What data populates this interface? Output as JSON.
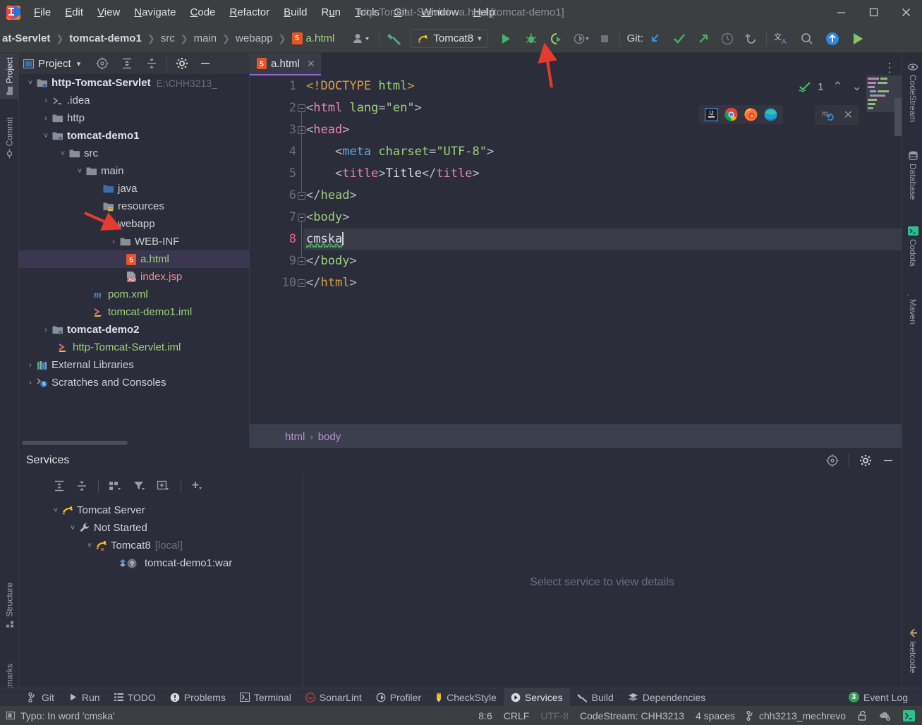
{
  "window": {
    "title": "http-Tomcat-Servlet - a.html [tomcat-demo1]",
    "minimize": "—",
    "maximize": "☐",
    "close": "✕"
  },
  "menu": [
    {
      "label": "File",
      "mnemonic": "F"
    },
    {
      "label": "Edit",
      "mnemonic": "E"
    },
    {
      "label": "View",
      "mnemonic": "V"
    },
    {
      "label": "Navigate",
      "mnemonic": "N"
    },
    {
      "label": "Code",
      "mnemonic": "C"
    },
    {
      "label": "Refactor",
      "mnemonic": "R"
    },
    {
      "label": "Build",
      "mnemonic": "B"
    },
    {
      "label": "Run",
      "mnemonic": "u"
    },
    {
      "label": "Tools",
      "mnemonic": "T"
    },
    {
      "label": "Git",
      "mnemonic": "G"
    },
    {
      "label": "Window",
      "mnemonic": "W"
    },
    {
      "label": "Help",
      "mnemonic": "H"
    }
  ],
  "navbar": {
    "crumbs": [
      {
        "label": "at-Servlet",
        "bold": true
      },
      {
        "label": "tomcat-demo1",
        "bold": true
      },
      {
        "label": "src",
        "bold": false
      },
      {
        "label": "main",
        "bold": false
      },
      {
        "label": "webapp",
        "bold": false
      },
      {
        "label": "a.html",
        "bold": false,
        "file": true,
        "badge": "5"
      }
    ],
    "run_config": "Tomcat8",
    "git_label": "Git:"
  },
  "left_strip": [
    {
      "label": "Project",
      "icon": "project-icon",
      "active": true
    },
    {
      "label": "Commit",
      "icon": "commit-icon",
      "active": false
    },
    {
      "label": "Structure",
      "icon": "structure-icon",
      "active": false
    },
    {
      "label": "Bookmarks",
      "icon": "bookmarks-icon",
      "active": false
    }
  ],
  "right_strip": [
    {
      "label": "CodeStream",
      "icon": "codestream-icon"
    },
    {
      "label": "Database",
      "icon": "database-icon"
    },
    {
      "label": "Codota",
      "icon": "codota-icon"
    },
    {
      "label": "Maven",
      "icon": "maven-icon"
    },
    {
      "label": "leetcode",
      "icon": "leetcode-icon"
    }
  ],
  "project_panel": {
    "title": "Project",
    "tree": [
      {
        "depth": 0,
        "arrow": "down",
        "icon": "module-folder-icon",
        "label": "http-Tomcat-Servlet",
        "bold": true,
        "path": "E:\\CHH3213_",
        "selected": false
      },
      {
        "depth": 1,
        "arrow": "right",
        "icon": "idea-folder-icon",
        "label": ".idea",
        "bold": false,
        "selected": false
      },
      {
        "depth": 1,
        "arrow": "right",
        "icon": "folder-icon",
        "label": "http",
        "bold": false,
        "selected": false
      },
      {
        "depth": 1,
        "arrow": "down",
        "icon": "module-folder-icon",
        "label": "tomcat-demo1",
        "bold": true,
        "selected": false
      },
      {
        "depth": 2,
        "arrow": "down",
        "icon": "folder-icon",
        "label": "src",
        "bold": false,
        "selected": false
      },
      {
        "depth": 3,
        "arrow": "down",
        "icon": "folder-icon",
        "label": "main",
        "bold": false,
        "selected": false
      },
      {
        "depth": 4,
        "arrow": "none",
        "icon": "source-folder-icon",
        "label": "java",
        "bold": false,
        "selected": false
      },
      {
        "depth": 4,
        "arrow": "none",
        "icon": "resource-folder-icon",
        "label": "resources",
        "bold": false,
        "selected": false
      },
      {
        "depth": 4,
        "arrow": "none",
        "icon": "webapp-folder-icon",
        "label": "webapp",
        "bold": false,
        "selected": false
      },
      {
        "depth": 5,
        "arrow": "right",
        "icon": "folder-icon",
        "label": "WEB-INF",
        "bold": false,
        "selected": false
      },
      {
        "depth": 5,
        "arrow": "none",
        "icon": "html5-file-icon",
        "label": "a.html",
        "bold": false,
        "color": "green",
        "selected": true
      },
      {
        "depth": 5,
        "arrow": "none",
        "icon": "jsp-file-icon",
        "label": "index.jsp",
        "bold": false,
        "color": "pink",
        "selected": false
      },
      {
        "depth": 4,
        "arrow": "none",
        "icon": "maven-pom-icon",
        "label": "pom.xml",
        "bold": false,
        "color": "green",
        "selected": false
      },
      {
        "depth": 4,
        "arrow": "none",
        "icon": "iml-file-icon",
        "label": "tomcat-demo1.iml",
        "bold": false,
        "color": "green",
        "selected": false
      },
      {
        "depth": 1,
        "arrow": "right",
        "icon": "module-folder-icon",
        "label": "tomcat-demo2",
        "bold": true,
        "selected": false
      },
      {
        "depth": 1,
        "arrow": "none",
        "icon": "iml-file-icon",
        "label": "http-Tomcat-Servlet.iml",
        "bold": false,
        "color": "green",
        "selected": false
      },
      {
        "depth": 0,
        "arrow": "right",
        "icon": "libraries-icon",
        "label": "External Libraries",
        "bold": false,
        "selected": false
      },
      {
        "depth": 0,
        "arrow": "right",
        "icon": "scratches-icon",
        "label": "Scratches and Consoles",
        "bold": false,
        "selected": false
      }
    ]
  },
  "editor": {
    "tab": {
      "label": "a.html",
      "badge": "5",
      "close": "✕"
    },
    "inspection": {
      "count": "1"
    },
    "browsers": [
      "ij-browser-icon",
      "chrome-icon",
      "firefox-icon",
      "edge-icon"
    ],
    "breadcrumb": [
      "html",
      "body"
    ],
    "lines": [
      {
        "n": "1",
        "fold": false,
        "current": false
      },
      {
        "n": "2",
        "fold": true,
        "current": false
      },
      {
        "n": "3",
        "fold": true,
        "current": false
      },
      {
        "n": "4",
        "fold": false,
        "current": false
      },
      {
        "n": "5",
        "fold": false,
        "current": false
      },
      {
        "n": "6",
        "fold": true,
        "current": false
      },
      {
        "n": "7",
        "fold": true,
        "current": false
      },
      {
        "n": "8",
        "fold": false,
        "current": true
      },
      {
        "n": "9",
        "fold": true,
        "current": false
      },
      {
        "n": "10",
        "fold": true,
        "current": false
      }
    ],
    "code_text": [
      "<!DOCTYPE html>",
      "<html lang=\"en\">",
      "<head>",
      "    <meta charset=\"UTF-8\">",
      "    <title>Title</title>",
      "</head>",
      "<body>",
      "cmska",
      "</body>",
      "</html>"
    ]
  },
  "services": {
    "title": "Services",
    "empty_message": "Select service to view details",
    "tree": [
      {
        "depth": 0,
        "arrow": "down",
        "icon": "tomcat-icon",
        "label": "Tomcat Server",
        "suffix": ""
      },
      {
        "depth": 1,
        "arrow": "down",
        "icon": "wrench-icon",
        "label": "Not Started",
        "suffix": ""
      },
      {
        "depth": 2,
        "arrow": "down",
        "icon": "tomcat-icon",
        "label": "Tomcat8",
        "suffix": "[local]"
      },
      {
        "depth": 3,
        "arrow": "none",
        "icon": "artifact-icon",
        "label": "tomcat-demo1:war",
        "suffix": ""
      }
    ]
  },
  "bottom_bar": [
    {
      "label": "Git",
      "icon": "git-branch-icon",
      "active": false
    },
    {
      "label": "Run",
      "icon": "run-icon",
      "active": false
    },
    {
      "label": "TODO",
      "icon": "todo-icon",
      "active": false
    },
    {
      "label": "Problems",
      "icon": "problems-icon",
      "active": false
    },
    {
      "label": "Terminal",
      "icon": "terminal-icon",
      "active": false
    },
    {
      "label": "SonarLint",
      "icon": "sonarlint-icon",
      "active": false
    },
    {
      "label": "Profiler",
      "icon": "profiler-icon",
      "active": false
    },
    {
      "label": "CheckStyle",
      "icon": "checkstyle-icon",
      "active": false
    },
    {
      "label": "Services",
      "icon": "services-icon",
      "active": true
    },
    {
      "label": "Build",
      "icon": "build-icon",
      "active": false
    },
    {
      "label": "Dependencies",
      "icon": "dependencies-icon",
      "active": false
    }
  ],
  "event_log": {
    "label": "Event Log",
    "count": "3"
  },
  "status_bar": {
    "message": "Typo: In word 'cmska'",
    "caret": "8:6",
    "line_sep": "CRLF",
    "encoding": "UTF-8",
    "codestream": "CodeStream:",
    "codestream_user": "CHH3213",
    "indent": "4 spaces",
    "branch": "chh3213_mechrevo"
  },
  "colors": {
    "accent_purple": "#8f67d8",
    "run_green": "#4caf6d",
    "tab_selected": "#3b3750",
    "titlebar": "#3c3f41",
    "background": "#2b2d3a",
    "annotation_red": "#e33b2e"
  }
}
